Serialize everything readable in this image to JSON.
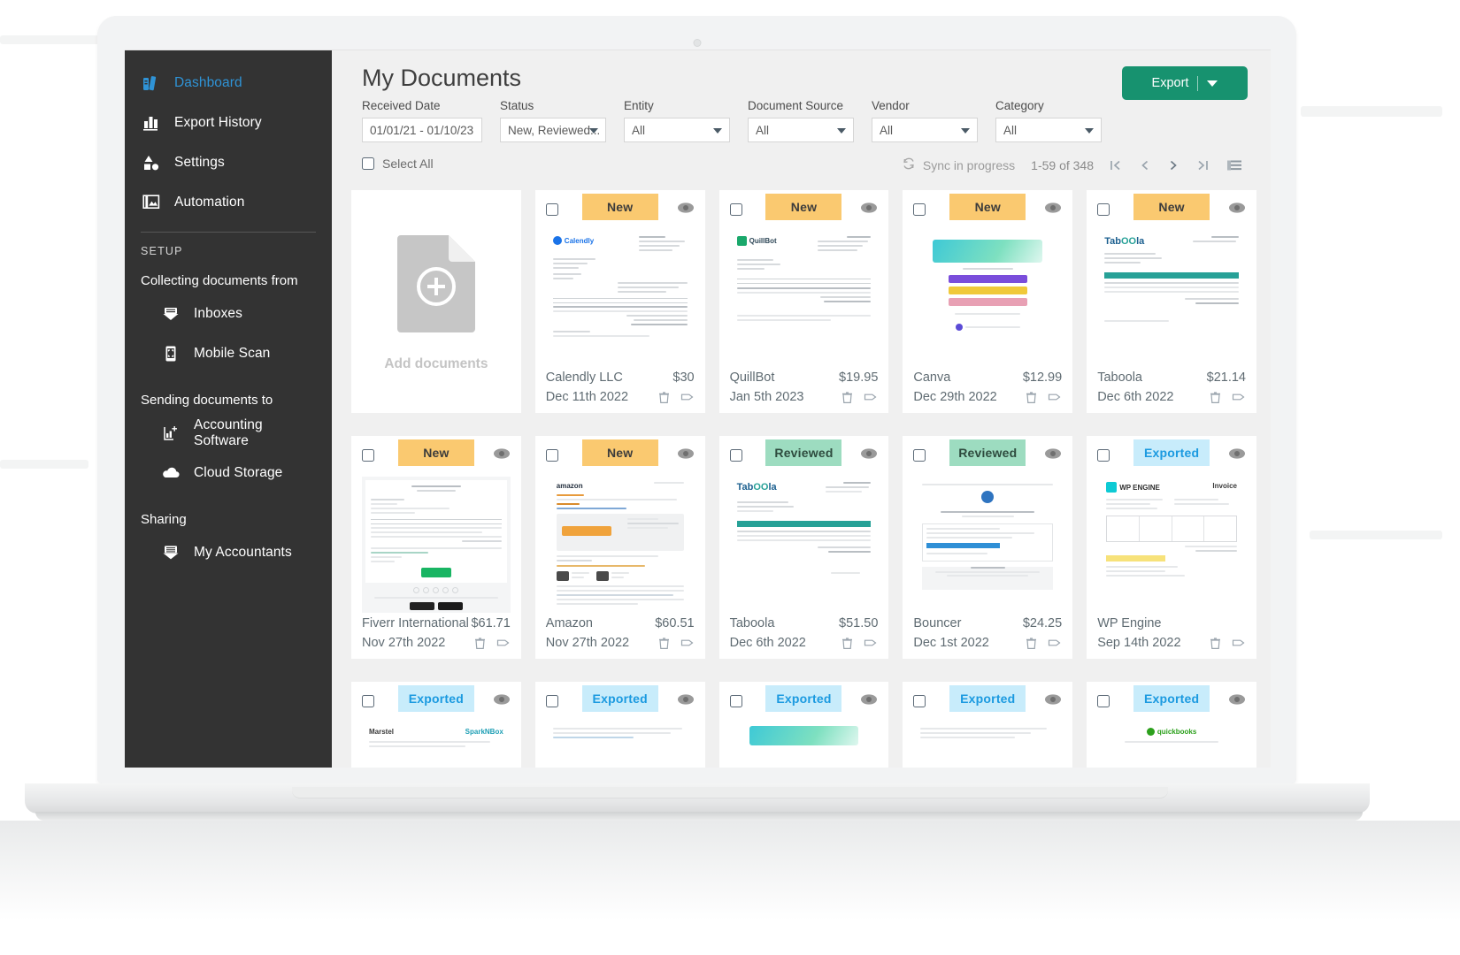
{
  "sidebar": {
    "items": [
      {
        "label": "Dashboard",
        "icon": "books-icon",
        "active": true
      },
      {
        "label": "Export History",
        "icon": "bar-chart-icon",
        "active": false
      },
      {
        "label": "Settings",
        "icon": "shapes-icon",
        "active": false
      },
      {
        "label": "Automation",
        "icon": "images-icon",
        "active": false
      }
    ],
    "setup_caption": "SETUP",
    "groups": [
      {
        "title": "Collecting documents from",
        "items": [
          {
            "label": "Inboxes",
            "icon": "inbox-envelope-icon"
          },
          {
            "label": "Mobile Scan",
            "icon": "mobile-scan-icon"
          }
        ]
      },
      {
        "title": "Sending documents to",
        "items": [
          {
            "label": "Accounting Software",
            "icon": "chart-plus-icon"
          },
          {
            "label": "Cloud Storage",
            "icon": "cloud-upload-icon"
          }
        ]
      },
      {
        "title": "Sharing",
        "items": [
          {
            "label": "My Accountants",
            "icon": "accountant-envelope-icon"
          }
        ]
      }
    ]
  },
  "header": {
    "title": "My Documents",
    "export_label": "Export"
  },
  "filters": [
    {
      "label": "Received Date",
      "value": "01/01/21 - 01/10/23",
      "type": "date",
      "has_caret": false
    },
    {
      "label": "Status",
      "value": "New, Reviewed...",
      "type": "select",
      "has_caret": true
    },
    {
      "label": "Entity",
      "value": "All",
      "type": "select",
      "has_caret": true
    },
    {
      "label": "Document Source",
      "value": "All",
      "type": "select",
      "has_caret": true
    },
    {
      "label": "Vendor",
      "value": "All",
      "type": "select",
      "has_caret": true
    },
    {
      "label": "Category",
      "value": "All",
      "type": "select",
      "has_caret": true
    }
  ],
  "toolbar": {
    "select_all_label": "Select All",
    "sync_label": "Sync in progress",
    "range_label": "1-59 of 348"
  },
  "add_card": {
    "label": "Add documents"
  },
  "colors": {
    "accent_green": "#17926f",
    "link_blue": "#2f93d6",
    "sidebar_bg": "#333333",
    "badge_new": "#fac970",
    "badge_reviewed": "#9ddcc0",
    "badge_exported": "#c8ecfb"
  },
  "documents": [
    {
      "vendor": "Calendly LLC",
      "amount": "$30",
      "date": "Dec 11th 2022",
      "status": "New",
      "thumb": "calendly"
    },
    {
      "vendor": "QuillBot",
      "amount": "$19.95",
      "date": "Jan 5th 2023",
      "status": "New",
      "thumb": "quillbot"
    },
    {
      "vendor": "Canva",
      "amount": "$12.99",
      "date": "Dec 29th 2022",
      "status": "New",
      "thumb": "canva"
    },
    {
      "vendor": "Taboola",
      "amount": "$21.14",
      "date": "Dec 6th 2022",
      "status": "New",
      "thumb": "taboola"
    },
    {
      "vendor": "Fiverr International",
      "amount": "$61.71",
      "date": "Nov 27th 2022",
      "status": "New",
      "thumb": "fiverr"
    },
    {
      "vendor": "Amazon",
      "amount": "$60.51",
      "date": "Nov 27th 2022",
      "status": "New",
      "thumb": "amazon"
    },
    {
      "vendor": "Taboola",
      "amount": "$51.50",
      "date": "Dec 6th 2022",
      "status": "Reviewed",
      "thumb": "taboola"
    },
    {
      "vendor": "Bouncer",
      "amount": "$24.25",
      "date": "Dec 1st 2022",
      "status": "Reviewed",
      "thumb": "bouncer"
    },
    {
      "vendor": "WP Engine",
      "amount": "",
      "date": "Sep 14th 2022",
      "status": "Exported",
      "thumb": "wpengine"
    },
    {
      "vendor": "",
      "amount": "",
      "date": "",
      "status": "Exported",
      "thumb": "generic1"
    },
    {
      "vendor": "",
      "amount": "",
      "date": "",
      "status": "Exported",
      "thumb": "generic2"
    },
    {
      "vendor": "",
      "amount": "",
      "date": "",
      "status": "Exported",
      "thumb": "canva"
    },
    {
      "vendor": "",
      "amount": "",
      "date": "",
      "status": "Exported",
      "thumb": "generic3"
    },
    {
      "vendor": "",
      "amount": "",
      "date": "",
      "status": "Exported",
      "thumb": "quickbooks"
    }
  ]
}
